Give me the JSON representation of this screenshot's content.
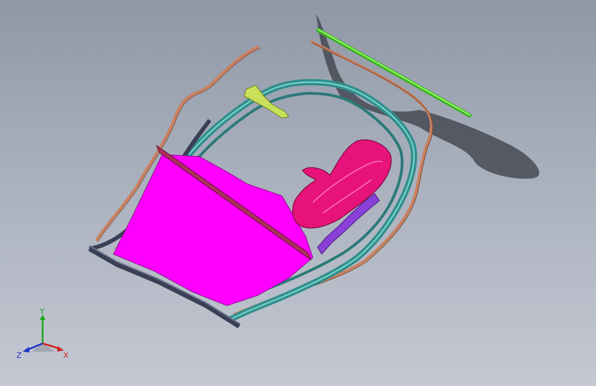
{
  "colors": {
    "background_top": "#8f97a6",
    "background_bottom": "#c4c8d2",
    "panel_fill": "#ff00ff",
    "inner_part": "#e8137a",
    "teal_rail": "#2f8f8c",
    "copper_strip": "#c9805f",
    "green_rod": "#4ddb2a",
    "purple_clips": "#8a3fd9",
    "dark_frame": "#3b3f55",
    "crossbar": "#b0305e",
    "bracket": "#c8e05a",
    "shadow": "#3a3d45"
  },
  "triad": {
    "x_label": "X",
    "y_label": "Y",
    "z_label": "Z",
    "x_color": "#d12020",
    "y_color": "#1aa81a",
    "z_color": "#2030c8"
  }
}
